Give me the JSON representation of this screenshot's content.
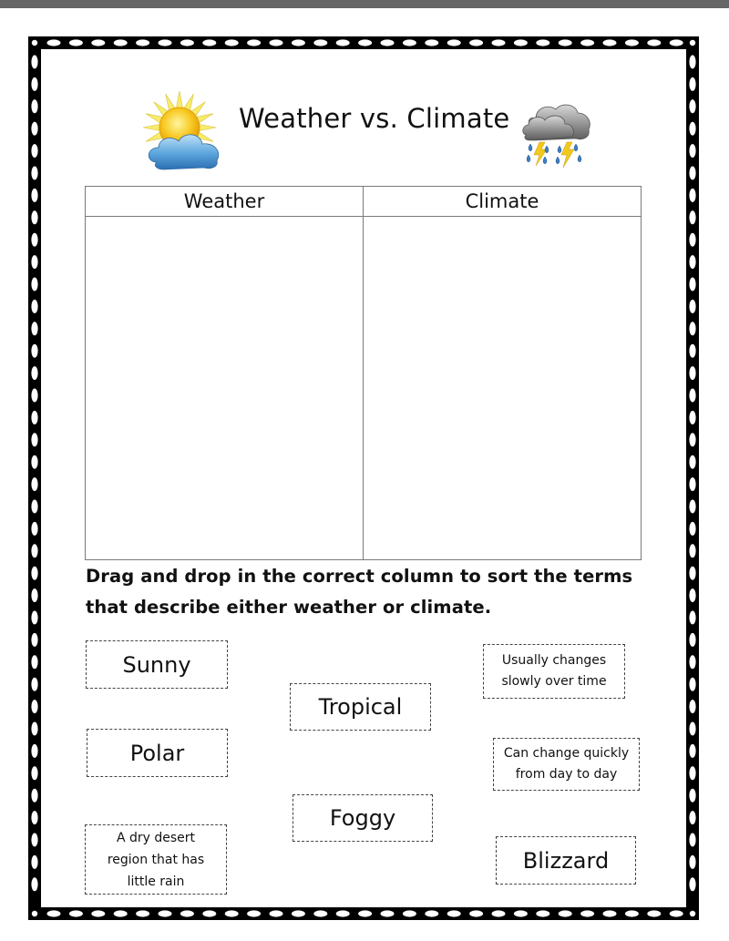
{
  "page": {
    "title": "Weather vs. Climate",
    "icons": {
      "left": "sun-behind-cloud-icon",
      "right": "thunderstorm-cloud-icon"
    }
  },
  "table": {
    "columns": [
      {
        "header": "Weather",
        "items": []
      },
      {
        "header": "Climate",
        "items": []
      }
    ]
  },
  "instructions": "Drag and drop in the correct column to sort the terms that describe either weather or climate.",
  "cards": [
    {
      "id": "sunny",
      "text": "Sunny"
    },
    {
      "id": "tropical",
      "text": "Tropical"
    },
    {
      "id": "usually-changes",
      "text": "Usually changes slowly over time"
    },
    {
      "id": "polar",
      "text": "Polar"
    },
    {
      "id": "can-change-quickly",
      "text": "Can change quickly from day to day"
    },
    {
      "id": "foggy",
      "text": "Foggy"
    },
    {
      "id": "dry-desert",
      "text": "A dry desert region that has little rain"
    },
    {
      "id": "blizzard",
      "text": "Blizzard"
    }
  ],
  "colors": {
    "frame": "#000000",
    "topbar": "#666666",
    "table_lines": "#7a7a7a",
    "sun": "#f5d21a",
    "cloud": "#4a8fcf",
    "storm_cloud": "#8a8a8a"
  }
}
